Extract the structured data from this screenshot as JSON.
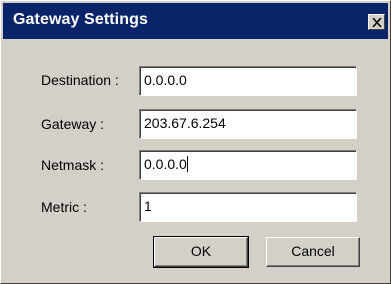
{
  "dialog": {
    "title": "Gateway Settings",
    "close_icon": "close-x-icon"
  },
  "fields": [
    {
      "label": "Destination :",
      "value": "0.0.0.0"
    },
    {
      "label": "Gateway :",
      "value": "203.67.6.254"
    },
    {
      "label": "Netmask :",
      "value": "0.0.0.0"
    },
    {
      "label": "Metric :",
      "value": "1"
    }
  ],
  "buttons": {
    "ok": "OK",
    "cancel": "Cancel"
  },
  "colors": {
    "titlebar": "#0a246a",
    "dialog_bg": "#d4d0c8"
  }
}
